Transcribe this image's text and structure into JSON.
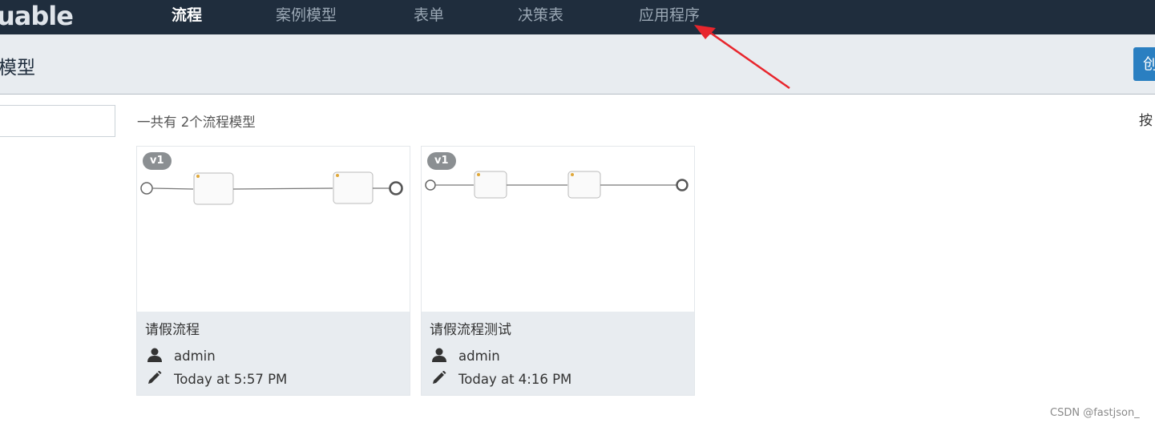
{
  "nav": {
    "logo": "uable",
    "items": [
      {
        "label": "流程",
        "active": true
      },
      {
        "label": "案例模型",
        "active": false
      },
      {
        "label": "表单",
        "active": false
      },
      {
        "label": "决策表",
        "active": false
      },
      {
        "label": "应用程序",
        "active": false
      }
    ]
  },
  "header": {
    "title": "模型",
    "create_label": "创"
  },
  "toolbar": {
    "count_text": "一共有 2个流程模型",
    "sort_text": "按"
  },
  "models": [
    {
      "version": "v1",
      "name": "请假流程",
      "author": "admin",
      "modified": "Today at 5:57 PM"
    },
    {
      "version": "v1",
      "name": "请假流程测试",
      "author": "admin",
      "modified": "Today at 4:16 PM"
    }
  ],
  "icons": {
    "author": "user-icon",
    "modified": "pencil-icon",
    "task": "user-task-icon"
  },
  "colors": {
    "nav_bg": "#1f2d3d",
    "header_bg": "#e8ecf0",
    "accent": "#2a7fc1",
    "annotation_arrow": "#e8262d"
  },
  "watermark": "CSDN @fastjson_"
}
